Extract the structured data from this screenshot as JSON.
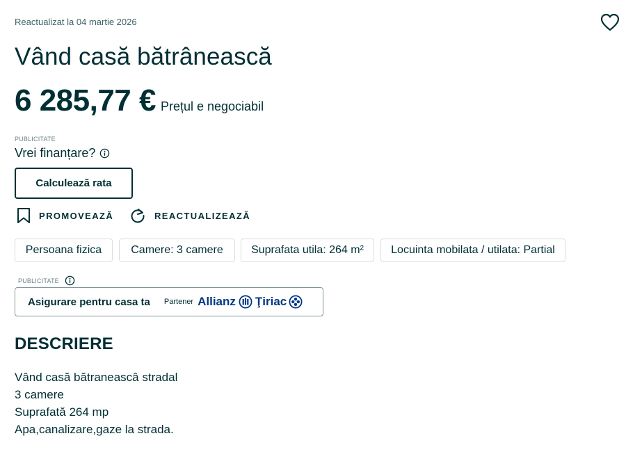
{
  "header": {
    "updated": "Reactualizat la 04 martie 2026",
    "favorite_icon": "heart-outline-icon"
  },
  "listing": {
    "title": "Vând casă bătrânească",
    "price": "6 285,77 €",
    "negotiable": "Prețul e negociabil"
  },
  "financing": {
    "ad_label": "PUBLICITATE",
    "question": "Vrei finanțare?",
    "info_icon": "info-circle-icon",
    "button": "Calculează rata"
  },
  "actions": {
    "promote": "PROMOVEAZĂ",
    "promote_icon": "bookmark-icon",
    "refresh": "REACTUALIZEAZĂ",
    "refresh_icon": "refresh-icon"
  },
  "attributes": [
    "Persoana fizica",
    "Camere: 3 camere",
    "Suprafata utila: 264 m²",
    "Locuinta mobilata / utilata: Partial"
  ],
  "insurance": {
    "ad_label": "PUBLICITATE",
    "text": "Asigurare pentru casa ta",
    "partner": "Partener",
    "brand_left": "Allianz",
    "brand_right": "Ţiriac",
    "brand_color": "#003781"
  },
  "description": {
    "title": "DESCRIERE",
    "lines": [
      "Vând casă bătraneascâ stradal",
      "3 camere",
      "Suprafată 264 mp",
      "Apa,canalizare,gaze la strada."
    ]
  },
  "colors": {
    "text": "#002f34",
    "muted": "#406367",
    "border": "#d8dfe0"
  }
}
